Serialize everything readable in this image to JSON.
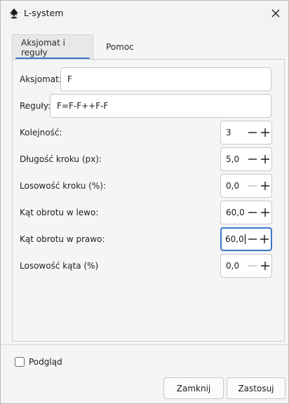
{
  "window": {
    "title": "L-system"
  },
  "tabs": [
    {
      "label": "Aksjomat i reguły"
    },
    {
      "label": "Pomoc"
    }
  ],
  "fields": {
    "axiom": {
      "label": "Aksjomat:",
      "value": "F"
    },
    "rules": {
      "label": "Reguły:",
      "value": "F=F-F++F-F"
    }
  },
  "spinners": [
    {
      "label": "Kolejność:",
      "value": "3"
    },
    {
      "label": "Długość kroku (px):",
      "value": "5,0"
    },
    {
      "label": "Losowość kroku (%):",
      "value": "0,0"
    },
    {
      "label": "Kąt obrotu w lewo:",
      "value": "60,0"
    },
    {
      "label": "Kąt obrotu w prawo:",
      "value": "60,0"
    },
    {
      "label": "Losowość kąta (%)",
      "value": "0,0"
    }
  ],
  "preview": {
    "label": "Podgląd",
    "checked": false
  },
  "buttons": {
    "close": "Zamknij",
    "apply": "Zastosuj"
  },
  "colors": {
    "accent": "#3a77c8",
    "disabled_icon": "#b5b5b5"
  }
}
